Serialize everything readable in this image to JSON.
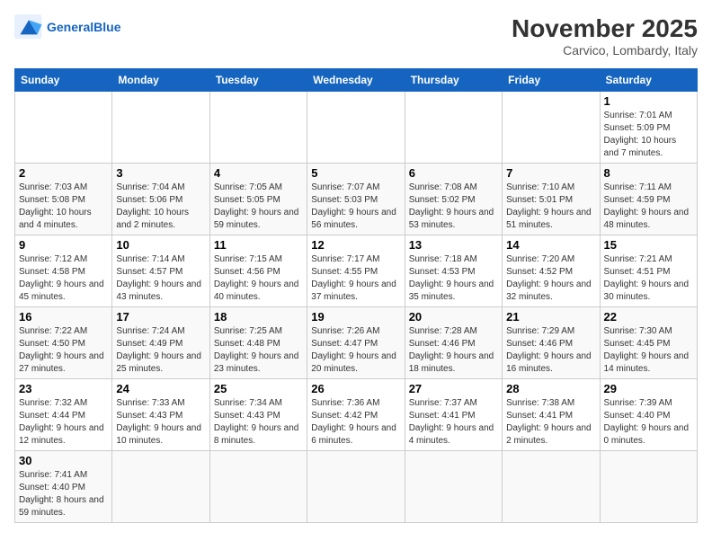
{
  "header": {
    "logo_general": "General",
    "logo_blue": "Blue",
    "month_title": "November 2025",
    "location": "Carvico, Lombardy, Italy"
  },
  "days_of_week": [
    "Sunday",
    "Monday",
    "Tuesday",
    "Wednesday",
    "Thursday",
    "Friday",
    "Saturday"
  ],
  "weeks": [
    [
      {
        "day": "",
        "info": ""
      },
      {
        "day": "",
        "info": ""
      },
      {
        "day": "",
        "info": ""
      },
      {
        "day": "",
        "info": ""
      },
      {
        "day": "",
        "info": ""
      },
      {
        "day": "",
        "info": ""
      },
      {
        "day": "1",
        "info": "Sunrise: 7:01 AM\nSunset: 5:09 PM\nDaylight: 10 hours and 7 minutes."
      }
    ],
    [
      {
        "day": "2",
        "info": "Sunrise: 7:03 AM\nSunset: 5:08 PM\nDaylight: 10 hours and 4 minutes."
      },
      {
        "day": "3",
        "info": "Sunrise: 7:04 AM\nSunset: 5:06 PM\nDaylight: 10 hours and 2 minutes."
      },
      {
        "day": "4",
        "info": "Sunrise: 7:05 AM\nSunset: 5:05 PM\nDaylight: 9 hours and 59 minutes."
      },
      {
        "day": "5",
        "info": "Sunrise: 7:07 AM\nSunset: 5:03 PM\nDaylight: 9 hours and 56 minutes."
      },
      {
        "day": "6",
        "info": "Sunrise: 7:08 AM\nSunset: 5:02 PM\nDaylight: 9 hours and 53 minutes."
      },
      {
        "day": "7",
        "info": "Sunrise: 7:10 AM\nSunset: 5:01 PM\nDaylight: 9 hours and 51 minutes."
      },
      {
        "day": "8",
        "info": "Sunrise: 7:11 AM\nSunset: 4:59 PM\nDaylight: 9 hours and 48 minutes."
      }
    ],
    [
      {
        "day": "9",
        "info": "Sunrise: 7:12 AM\nSunset: 4:58 PM\nDaylight: 9 hours and 45 minutes."
      },
      {
        "day": "10",
        "info": "Sunrise: 7:14 AM\nSunset: 4:57 PM\nDaylight: 9 hours and 43 minutes."
      },
      {
        "day": "11",
        "info": "Sunrise: 7:15 AM\nSunset: 4:56 PM\nDaylight: 9 hours and 40 minutes."
      },
      {
        "day": "12",
        "info": "Sunrise: 7:17 AM\nSunset: 4:55 PM\nDaylight: 9 hours and 37 minutes."
      },
      {
        "day": "13",
        "info": "Sunrise: 7:18 AM\nSunset: 4:53 PM\nDaylight: 9 hours and 35 minutes."
      },
      {
        "day": "14",
        "info": "Sunrise: 7:20 AM\nSunset: 4:52 PM\nDaylight: 9 hours and 32 minutes."
      },
      {
        "day": "15",
        "info": "Sunrise: 7:21 AM\nSunset: 4:51 PM\nDaylight: 9 hours and 30 minutes."
      }
    ],
    [
      {
        "day": "16",
        "info": "Sunrise: 7:22 AM\nSunset: 4:50 PM\nDaylight: 9 hours and 27 minutes."
      },
      {
        "day": "17",
        "info": "Sunrise: 7:24 AM\nSunset: 4:49 PM\nDaylight: 9 hours and 25 minutes."
      },
      {
        "day": "18",
        "info": "Sunrise: 7:25 AM\nSunset: 4:48 PM\nDaylight: 9 hours and 23 minutes."
      },
      {
        "day": "19",
        "info": "Sunrise: 7:26 AM\nSunset: 4:47 PM\nDaylight: 9 hours and 20 minutes."
      },
      {
        "day": "20",
        "info": "Sunrise: 7:28 AM\nSunset: 4:46 PM\nDaylight: 9 hours and 18 minutes."
      },
      {
        "day": "21",
        "info": "Sunrise: 7:29 AM\nSunset: 4:46 PM\nDaylight: 9 hours and 16 minutes."
      },
      {
        "day": "22",
        "info": "Sunrise: 7:30 AM\nSunset: 4:45 PM\nDaylight: 9 hours and 14 minutes."
      }
    ],
    [
      {
        "day": "23",
        "info": "Sunrise: 7:32 AM\nSunset: 4:44 PM\nDaylight: 9 hours and 12 minutes."
      },
      {
        "day": "24",
        "info": "Sunrise: 7:33 AM\nSunset: 4:43 PM\nDaylight: 9 hours and 10 minutes."
      },
      {
        "day": "25",
        "info": "Sunrise: 7:34 AM\nSunset: 4:43 PM\nDaylight: 9 hours and 8 minutes."
      },
      {
        "day": "26",
        "info": "Sunrise: 7:36 AM\nSunset: 4:42 PM\nDaylight: 9 hours and 6 minutes."
      },
      {
        "day": "27",
        "info": "Sunrise: 7:37 AM\nSunset: 4:41 PM\nDaylight: 9 hours and 4 minutes."
      },
      {
        "day": "28",
        "info": "Sunrise: 7:38 AM\nSunset: 4:41 PM\nDaylight: 9 hours and 2 minutes."
      },
      {
        "day": "29",
        "info": "Sunrise: 7:39 AM\nSunset: 4:40 PM\nDaylight: 9 hours and 0 minutes."
      }
    ],
    [
      {
        "day": "30",
        "info": "Sunrise: 7:41 AM\nSunset: 4:40 PM\nDaylight: 8 hours and 59 minutes."
      },
      {
        "day": "",
        "info": ""
      },
      {
        "day": "",
        "info": ""
      },
      {
        "day": "",
        "info": ""
      },
      {
        "day": "",
        "info": ""
      },
      {
        "day": "",
        "info": ""
      },
      {
        "day": "",
        "info": ""
      }
    ]
  ]
}
